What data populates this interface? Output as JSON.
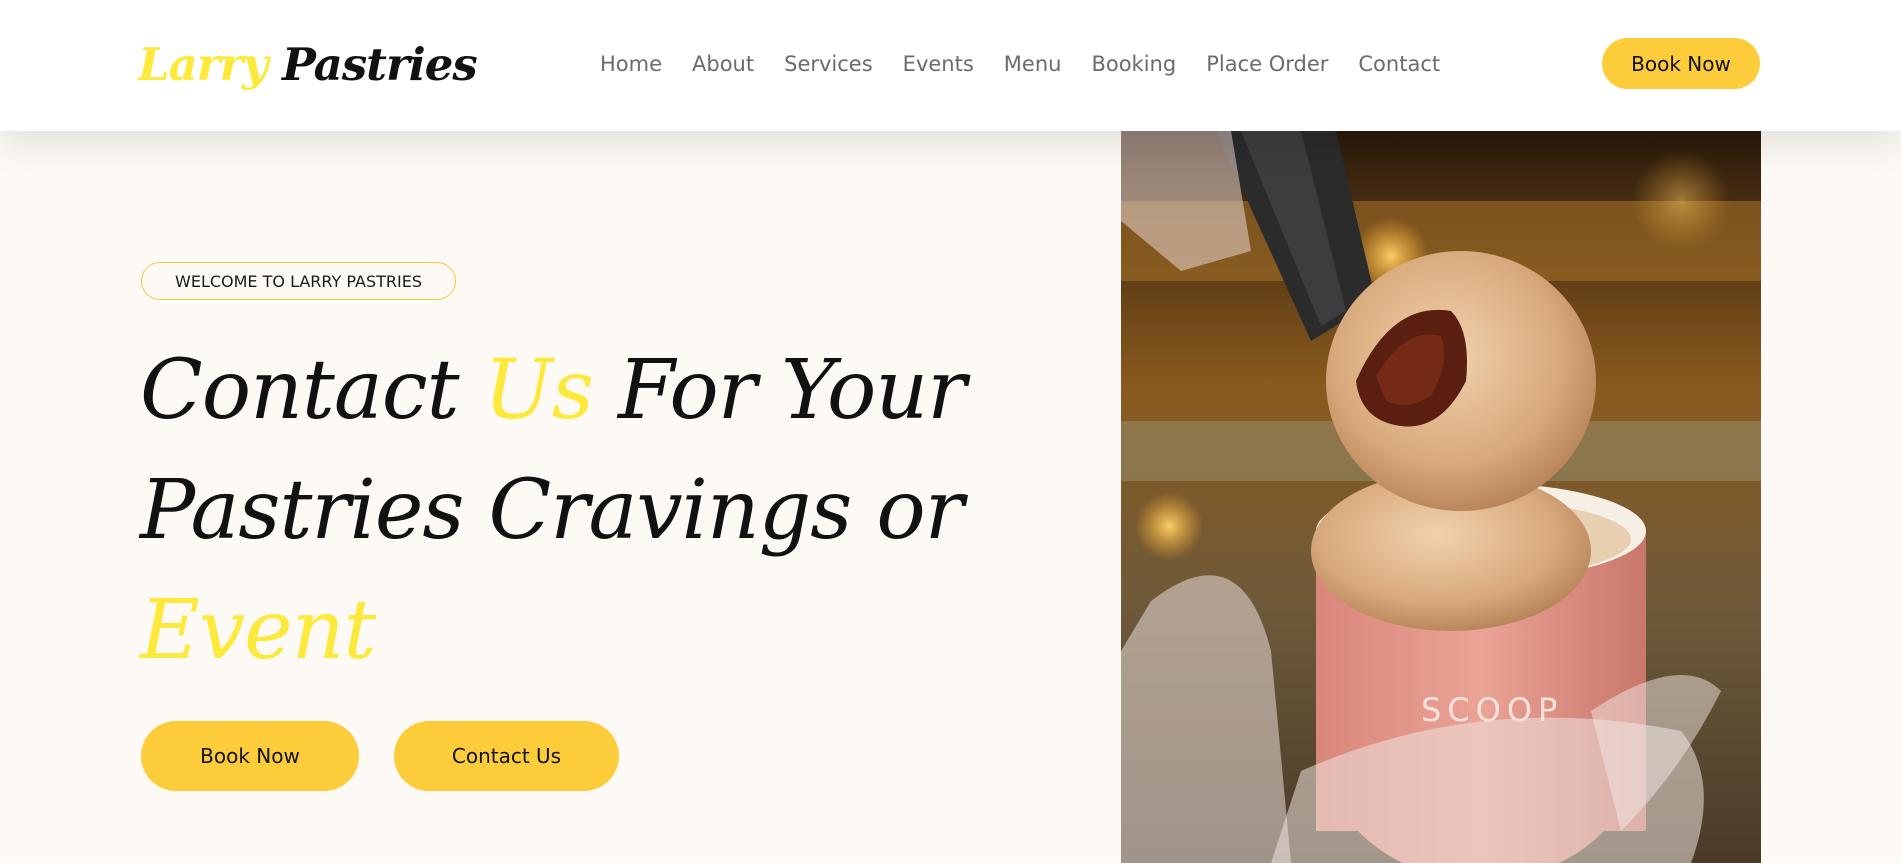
{
  "header": {
    "logo": {
      "part1": "Larry",
      "part2": "Pastries"
    },
    "nav": [
      "Home",
      "About",
      "Services",
      "Events",
      "Menu",
      "Booking",
      "Place Order",
      "Contact"
    ],
    "cta_label": "Book Now"
  },
  "hero": {
    "badge": "WELCOME TO LARRY PASTRIES",
    "headline": {
      "w1": "Contact",
      "w2": "Us",
      "w3": "For Your",
      "w4": "Pastries Cravings or",
      "w5": "Event"
    },
    "buttons": {
      "book": "Book Now",
      "contact": "Contact Us"
    },
    "image_cup_text": "SCOOP"
  },
  "colors": {
    "accent": "#fdcc3b",
    "accent_text": "#fde93b",
    "background": "#fdfaf5",
    "nav_text": "#6b6b6b"
  }
}
